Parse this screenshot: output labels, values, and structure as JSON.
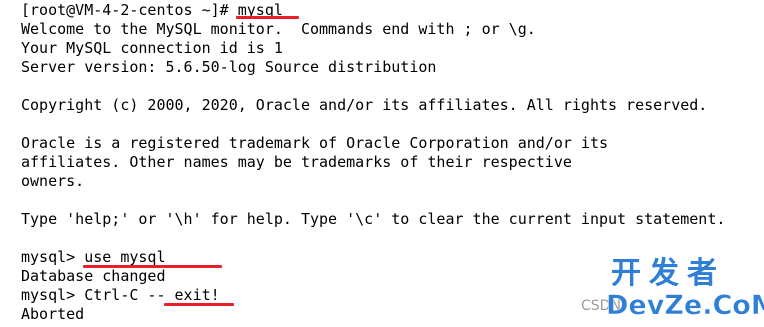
{
  "terminal": {
    "lines": [
      "[root@VM-4-2-centos ~]# mysql",
      "Welcome to the MySQL monitor.  Commands end with ; or \\g.",
      "Your MySQL connection id is 1",
      "Server version: 5.6.50-log Source distribution",
      "",
      "Copyright (c) 2000, 2020, Oracle and/or its affiliates. All rights reserved.",
      "",
      "Oracle is a registered trademark of Oracle Corporation and/or its",
      "affiliates. Other names may be trademarks of their respective",
      "owners.",
      "",
      "Type 'help;' or '\\h' for help. Type '\\c' to clear the current input statement.",
      "",
      "mysql> use mysql",
      "Database changed",
      "mysql> Ctrl-C -- exit!",
      "Aborted"
    ],
    "annotation_color": "#e8202a"
  },
  "watermark": {
    "chinese": "开发者",
    "small": "CSDN",
    "english": "DevZe.CoM",
    "color": "#2f7fd6"
  }
}
